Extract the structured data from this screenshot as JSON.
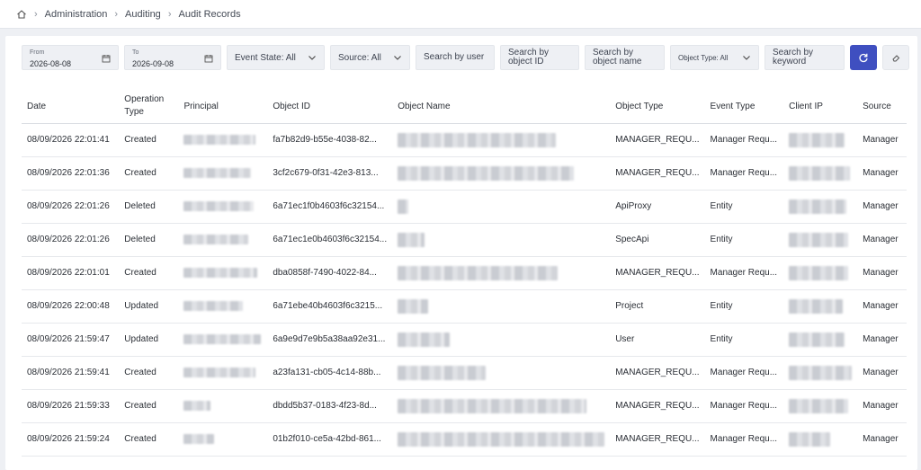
{
  "breadcrumb": {
    "items": [
      "Administration",
      "Auditing",
      "Audit Records"
    ]
  },
  "filters": {
    "from": {
      "label": "From",
      "value": "2026-08-08"
    },
    "to": {
      "label": "To",
      "value": "2026-09-08"
    },
    "event_state": "Event State: All",
    "source": "Source: All",
    "search_user": "Search by user",
    "search_object_id": "Search by object ID",
    "search_object_name": "Search by object name",
    "object_type": "Object Type: All",
    "search_keyword": "Search by keyword"
  },
  "table": {
    "headers": {
      "date": "Date",
      "operation_type": "Operation Type",
      "principal": "Principal",
      "object_id": "Object ID",
      "object_name": "Object Name",
      "object_type": "Object Type",
      "event_type": "Event Type",
      "client_ip": "Client IP",
      "source": "Source"
    },
    "rows": [
      {
        "date": "08/09/2026 22:01:41",
        "op": "Created",
        "object_id": "fa7b82d9-b55e-4038-82...",
        "object_type": "MANAGER_REQU...",
        "event_type": "Manager Requ...",
        "source": "Manager"
      },
      {
        "date": "08/09/2026 22:01:36",
        "op": "Created",
        "object_id": "3cf2c679-0f31-42e3-813...",
        "object_type": "MANAGER_REQU...",
        "event_type": "Manager Requ...",
        "source": "Manager"
      },
      {
        "date": "08/09/2026 22:01:26",
        "op": "Deleted",
        "object_id": "6a71ec1f0b4603f6c32154...",
        "object_type": "ApiProxy",
        "event_type": "Entity",
        "source": "Manager"
      },
      {
        "date": "08/09/2026 22:01:26",
        "op": "Deleted",
        "object_id": "6a71ec1e0b4603f6c32154...",
        "object_type": "SpecApi",
        "event_type": "Entity",
        "source": "Manager"
      },
      {
        "date": "08/09/2026 22:01:01",
        "op": "Created",
        "object_id": "dba0858f-7490-4022-84...",
        "object_type": "MANAGER_REQU...",
        "event_type": "Manager Requ...",
        "source": "Manager"
      },
      {
        "date": "08/09/2026 22:00:48",
        "op": "Updated",
        "object_id": "6a71ebe40b4603f6c3215...",
        "object_type": "Project",
        "event_type": "Entity",
        "source": "Manager"
      },
      {
        "date": "08/09/2026 21:59:47",
        "op": "Updated",
        "object_id": "6a9e9d7e9b5a38aa92e31...",
        "object_type": "User",
        "event_type": "Entity",
        "source": "Manager"
      },
      {
        "date": "08/09/2026 21:59:41",
        "op": "Created",
        "object_id": "a23fa131-cb05-4c14-88b...",
        "object_type": "MANAGER_REQU...",
        "event_type": "Manager Requ...",
        "source": "Manager"
      },
      {
        "date": "08/09/2026 21:59:33",
        "op": "Created",
        "object_id": "dbdd5b37-0183-4f23-8d...",
        "object_type": "MANAGER_REQU...",
        "event_type": "Manager Requ...",
        "source": "Manager"
      },
      {
        "date": "08/09/2026 21:59:24",
        "op": "Created",
        "object_id": "01b2f010-ce5a-42bd-861...",
        "object_type": "MANAGER_REQU...",
        "event_type": "Manager Requ...",
        "source": "Manager"
      }
    ]
  },
  "colors": {
    "accent": "#3f4fc0",
    "background": "#eef0f4",
    "panel": "#ffffff"
  }
}
